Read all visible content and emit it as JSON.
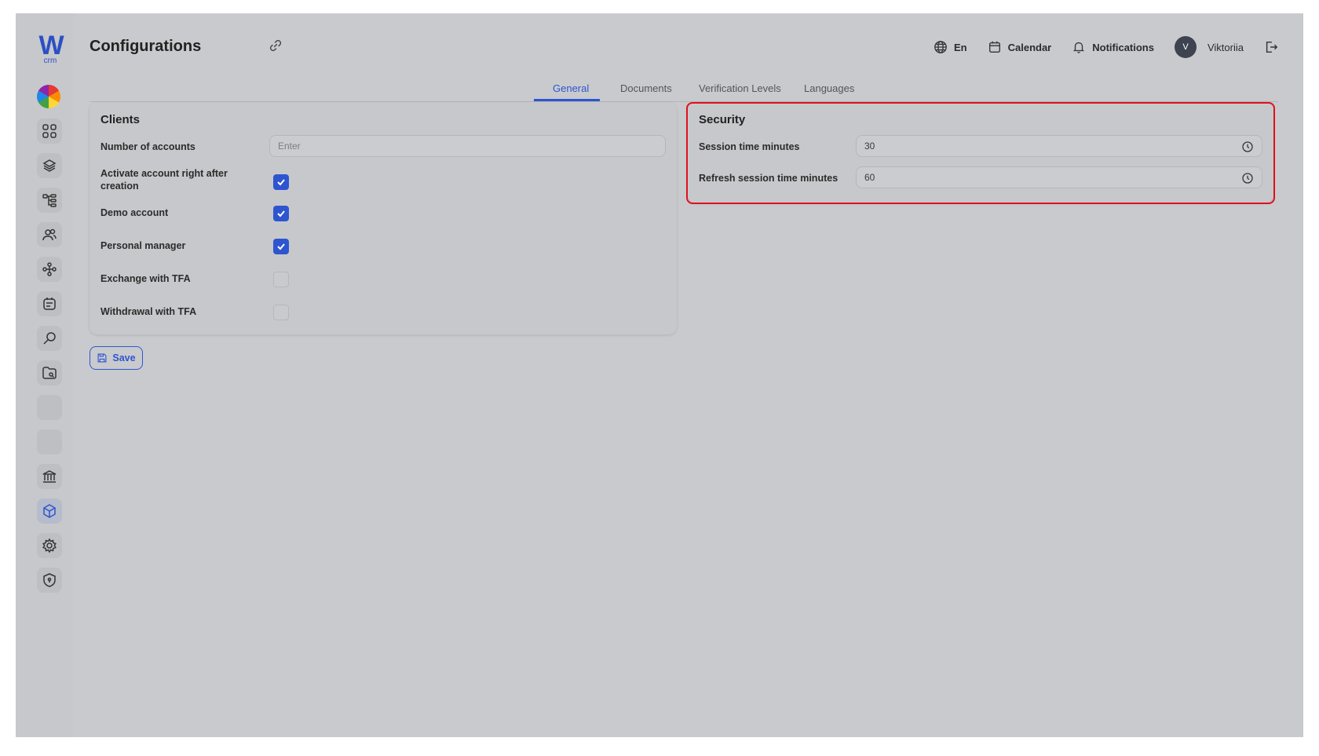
{
  "brand": {
    "logo_letter": "W",
    "logo_sub": "crm",
    "accent": "#2e55d0"
  },
  "sidebar": {
    "items": [
      {
        "name": "dashboard-icon"
      },
      {
        "name": "layers-icon"
      },
      {
        "name": "hierarchy-icon"
      },
      {
        "name": "users-icon"
      },
      {
        "name": "network-icon"
      },
      {
        "name": "tasks-icon"
      },
      {
        "name": "search-key-icon"
      },
      {
        "name": "folder-icon"
      },
      {
        "name": "blank-1"
      },
      {
        "name": "blank-2"
      },
      {
        "name": "bank-icon"
      },
      {
        "name": "cube-icon",
        "active": true
      },
      {
        "name": "gear-icon"
      },
      {
        "name": "shield-icon"
      }
    ]
  },
  "header": {
    "title": "Configurations",
    "language": "En",
    "calendar": "Calendar",
    "notifications": "Notifications",
    "avatar_initial": "V",
    "user_name": "Viktoriia"
  },
  "tabs": [
    {
      "label": "General",
      "active": true
    },
    {
      "label": "Documents"
    },
    {
      "label": "Verification Levels"
    },
    {
      "label": "Languages"
    }
  ],
  "clients": {
    "title": "Clients",
    "number_of_accounts_label": "Number of accounts",
    "number_of_accounts_placeholder": "Enter",
    "activate_label_line1": "Activate account right after",
    "activate_label_line2": "creation",
    "activate_checked": true,
    "demo_label": "Demo account",
    "demo_checked": true,
    "personal_manager_label": "Personal manager",
    "personal_manager_checked": true,
    "exchange_tfa_label": "Exchange with TFA",
    "exchange_tfa_checked": false,
    "withdrawal_tfa_label": "Withdrawal with TFA",
    "withdrawal_tfa_checked": false
  },
  "security": {
    "title": "Security",
    "session_label": "Session time minutes",
    "session_value": "30",
    "refresh_label": "Refresh session time minutes",
    "refresh_value": "60",
    "highlight_color": "#e0111b"
  },
  "save_label": "Save"
}
